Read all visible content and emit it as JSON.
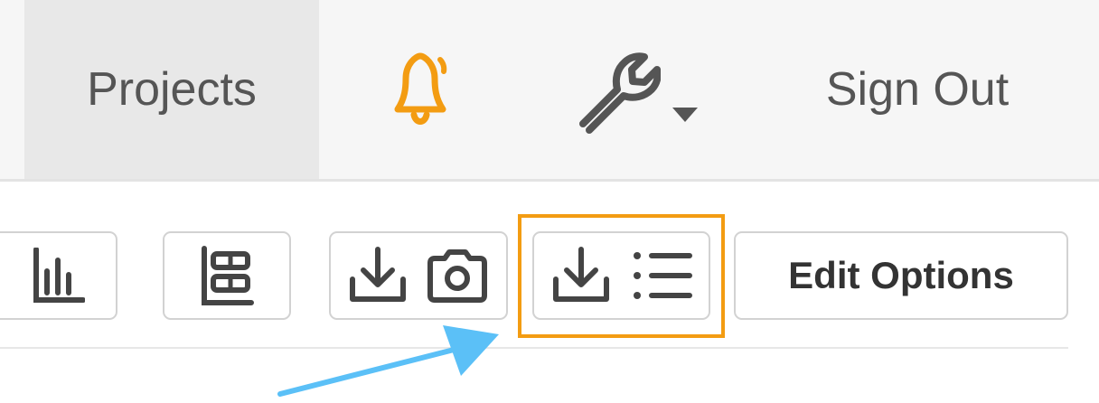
{
  "nav": {
    "projects_label": "Projects",
    "bell_icon": "bell-icon",
    "tools_icon": "wrench-icon",
    "tools_dropdown_icon": "caret-down-icon",
    "signout_label": "Sign Out"
  },
  "toolbar": {
    "bar_chart_icon": "bar-chart-icon",
    "layout_icon": "layout-icon",
    "download_image_icons": [
      "download-icon",
      "camera-icon"
    ],
    "download_data_icons": [
      "download-icon",
      "list-icon"
    ],
    "edit_options_label": "Edit Options"
  },
  "annotations": {
    "highlight_color": "#f39c12",
    "arrow_color": "#5bc0f7"
  },
  "colors": {
    "bell_accent": "#f39c12",
    "icon_gray": "#444444"
  }
}
